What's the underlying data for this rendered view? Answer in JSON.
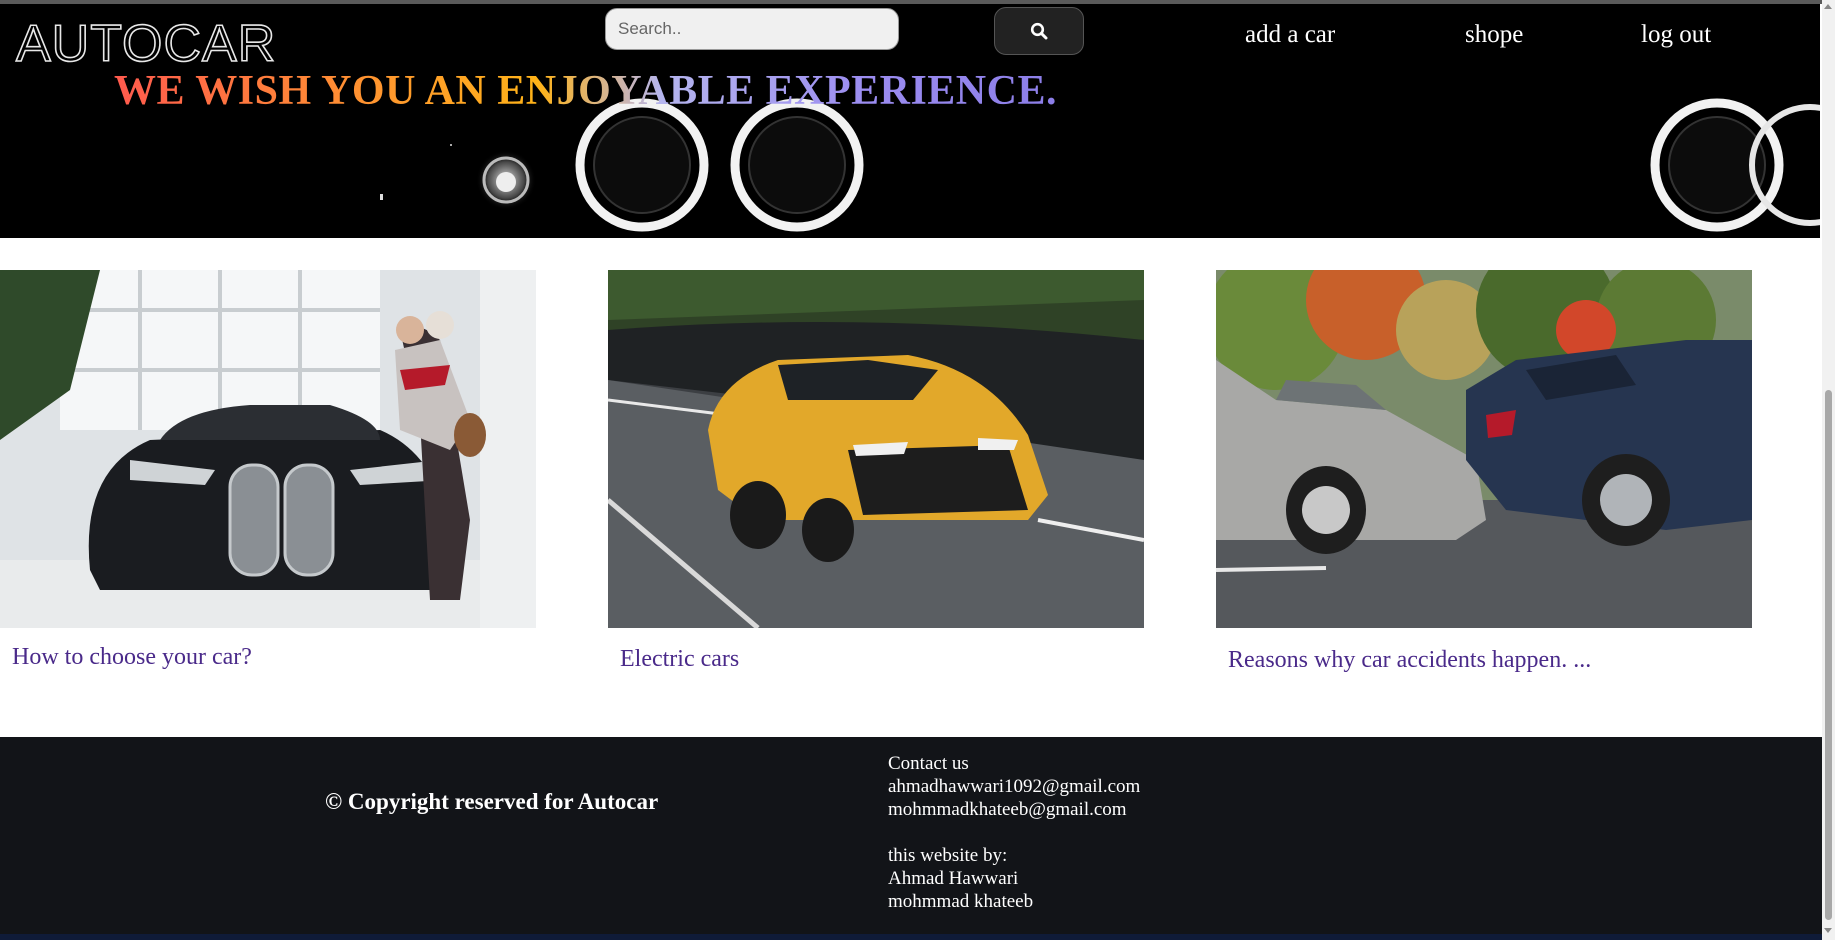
{
  "header": {
    "logo": "AUTOCAR",
    "search_placeholder": "Search..",
    "search_icon": "magnifier",
    "nav": [
      {
        "label": "add a car"
      },
      {
        "label": "shope"
      },
      {
        "label": "log out"
      }
    ],
    "tagline": "WE WISH YOU AN ENJOYABLE EXPERIENCE."
  },
  "cards": [
    {
      "title": "How to choose your car?",
      "image": "black convertible in showroom"
    },
    {
      "title": "Electric cars",
      "image": "yellow suv on road"
    },
    {
      "title": "Reasons why car accidents happen. ...",
      "image": "two cars collision"
    }
  ],
  "footer": {
    "copyright": "© Copyright reserved for Autocar",
    "contact_heading": "Contact us",
    "emails": [
      "ahmadhawwari1092@gmail.com",
      "mohmmadkhateeb@gmail.com"
    ],
    "credits_heading": "this website by:",
    "authors": [
      "Ahmad Hawwari",
      "mohmmad khateeb"
    ]
  },
  "colors": {
    "hero_bg": "#000000",
    "footer_bg": "#121418",
    "link_purple": "#4a2a8a"
  }
}
